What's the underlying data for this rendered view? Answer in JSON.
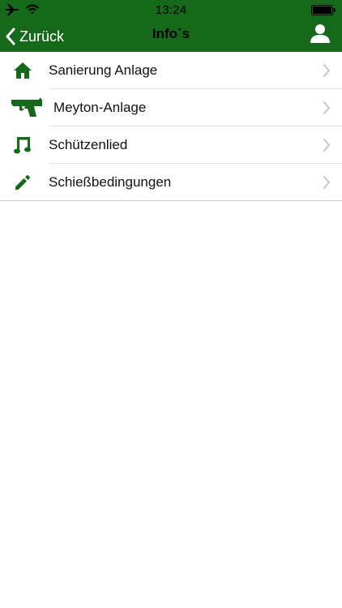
{
  "status_bar": {
    "time": "13:24",
    "icons": [
      "airplane-icon",
      "wifi-icon",
      "battery-icon"
    ]
  },
  "nav": {
    "back_label": "Zurück",
    "title": "Info´s",
    "profile_icon": "person-icon"
  },
  "menu": {
    "items": [
      {
        "label": "Sanierung Anlage",
        "icon": "home-icon"
      },
      {
        "label": "Meyton-Anlage",
        "icon": "pistol-icon"
      },
      {
        "label": "Schützenlied",
        "icon": "music-note-icon"
      },
      {
        "label": "Schießbedingungen",
        "icon": "pencil-icon"
      }
    ]
  },
  "colors": {
    "header_bg": "#16691a",
    "icon_green": "#16691a",
    "chevron": "#c7c7cc",
    "separator": "#e4e4e4"
  }
}
